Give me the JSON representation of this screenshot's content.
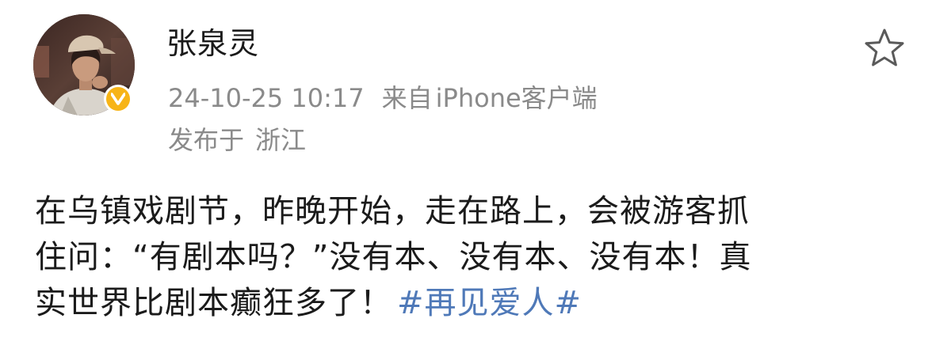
{
  "post": {
    "user": {
      "name": "张泉灵",
      "verified": true,
      "badge_color": "#f7b417"
    },
    "time": "24-10-25 10:17",
    "via_prefix": "来自",
    "via_app": "iPhone客户端",
    "location_label": "发布于",
    "location": "浙江",
    "text_lines": [
      "在乌镇戏剧节，昨晚开始，走在路上，会被游客抓",
      "住问：“有剧本吗？”没有本、没有本、没有本！真",
      "实世界比剧本癫狂多了！"
    ],
    "hashtag": "#再见爱人#",
    "hashtag_color": "#4f79b8",
    "meta_color": "#8a8a8a"
  },
  "icons": {
    "favorite": "star-outline-icon",
    "verified": "verified-v-icon"
  }
}
